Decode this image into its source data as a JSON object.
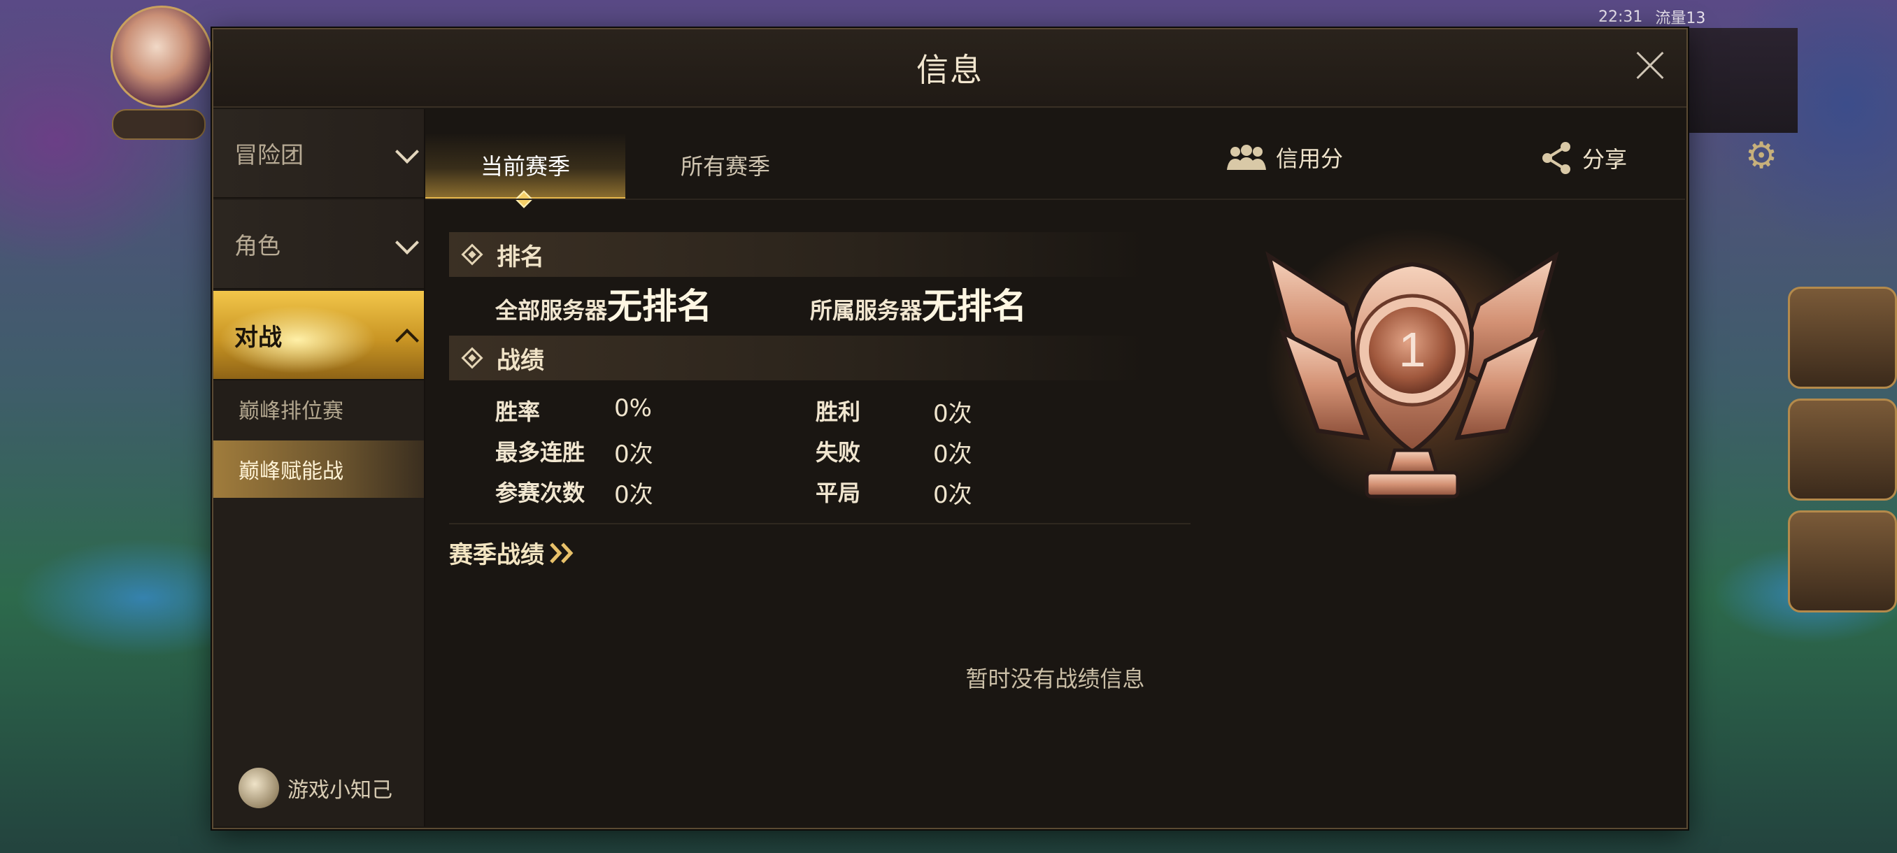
{
  "status_bar": {
    "time": "22:31",
    "network": "流量13"
  },
  "dialog": {
    "title": "信息"
  },
  "sidebar": {
    "items": [
      {
        "label": "冒险团"
      },
      {
        "label": "角色"
      },
      {
        "label": "对战"
      }
    ],
    "sub_items": [
      {
        "label": "巅峰排位赛"
      },
      {
        "label": "巅峰赋能战"
      }
    ],
    "tips_label": "游戏小知己"
  },
  "tabs": [
    {
      "label": "当前赛季"
    },
    {
      "label": "所有赛季"
    }
  ],
  "credit_label": "信用分",
  "share_label": "分享",
  "ranking": {
    "header": "排名",
    "all_server_label": "全部服务器",
    "all_server_value": "无排名",
    "own_server_label": "所属服务器",
    "own_server_value": "无排名"
  },
  "record": {
    "header": "战绩",
    "win_rate_label": "胜率",
    "win_rate": "0%",
    "max_streak_label": "最多连胜",
    "max_streak": "0次",
    "matches_label": "参赛次数",
    "matches": "0次",
    "wins_label": "胜利",
    "wins": "0次",
    "losses_label": "失败",
    "losses": "0次",
    "draws_label": "平局",
    "draws": "0次"
  },
  "season_record_link": "赛季战绩",
  "empty_message": "暂时没有战绩信息",
  "badge": {
    "number": "1",
    "color": "#c9846a",
    "icon": "bronze-trophy-icon"
  },
  "colors": {
    "accent_gold": "#e8b84e",
    "panel_bg": "#1b1713"
  }
}
